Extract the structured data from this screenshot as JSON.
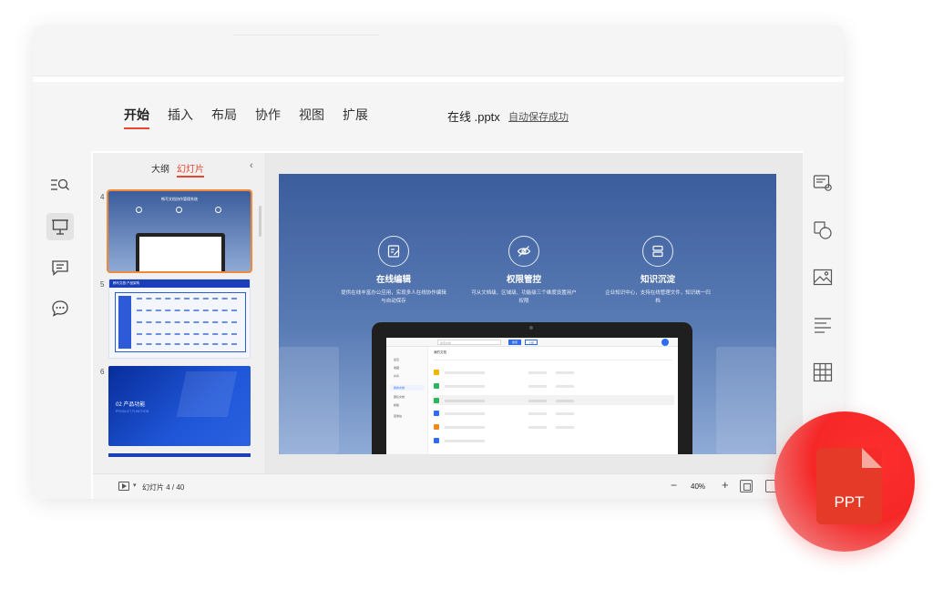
{
  "menu": {
    "items": [
      "开始",
      "插入",
      "布局",
      "协作",
      "视图",
      "扩展"
    ],
    "active_index": 0
  },
  "document": {
    "title": "在线 .pptx",
    "save_status": "自动保存成功"
  },
  "left_sidebar": {
    "icons": [
      "outline-search-icon",
      "presentation-icon",
      "comment-icon",
      "chat-icon"
    ],
    "active_index": 1
  },
  "right_sidebar": {
    "icons": [
      "slide-settings-icon",
      "shapes-icon",
      "image-icon",
      "text-align-icon",
      "table-icon"
    ]
  },
  "thumbnail_panel": {
    "tabs": [
      "大纲",
      "幻灯片"
    ],
    "active_tab": 1,
    "collapse_icon": "chevron-left-icon",
    "slides": [
      {
        "number": "4",
        "title": "畅写文档协作管理系统",
        "selected": true
      },
      {
        "number": "5",
        "title": "畅写文档·产品架构",
        "selected": false
      },
      {
        "number": "6",
        "title": "02 产品功能",
        "subtitle": "PRODUCT FUNCTION",
        "selected": false
      }
    ]
  },
  "slide": {
    "features": [
      {
        "icon": "edit-doc-icon",
        "title": "在线编辑",
        "desc": "提供在线丰富办公应用，实现多人在线协作编辑与自动保存"
      },
      {
        "icon": "eye-off-icon",
        "title": "权限管控",
        "desc": "可从文档级、区域级、功能级三个维度设置用户权限"
      },
      {
        "icon": "knowledge-icon",
        "title": "知识沉淀",
        "desc": "企业知识中心，支持在线管理文件，知识统一归档"
      }
    ],
    "app": {
      "search_placeholder": "搜索文档",
      "search_button": "搜索",
      "upload_button": "上传",
      "breadcrumb": "我的文档",
      "nav": [
        "最近",
        "收藏",
        "共享",
        "我的文档",
        "团队文档",
        "模板",
        "回收站"
      ]
    }
  },
  "statusbar": {
    "slide_counter": "幻灯片 4 / 40",
    "zoom": "40%",
    "zoom_out": "−",
    "zoom_in": "+"
  },
  "badge": {
    "label": "PPT"
  },
  "colors": {
    "accent": "#e8452d",
    "badge_red": "#f52727",
    "slide_blue": "#3c5d9c"
  }
}
